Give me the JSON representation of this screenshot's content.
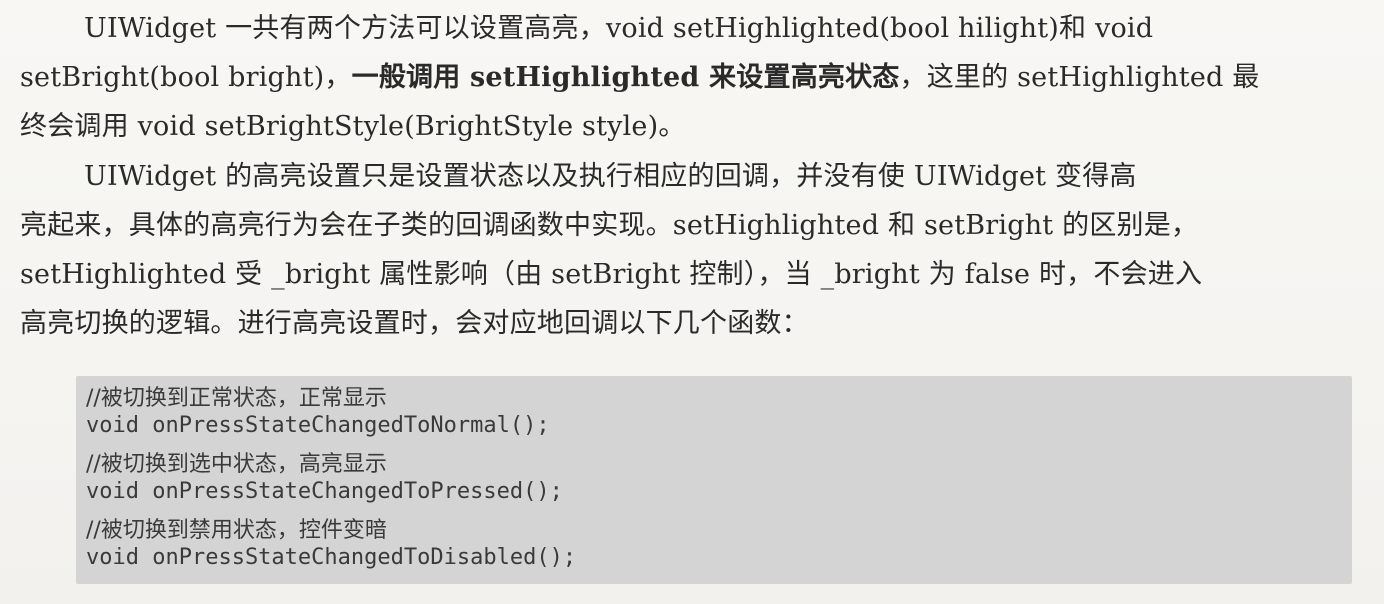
{
  "paragraph1": {
    "line1": "UIWidget 一共有两个方法可以设置高亮，void setHighlighted(bool hilight)和 void",
    "line2_pre": "setBright(bool bright)，",
    "line2_bold": "一般调用 setHighlighted 来设置高亮状态",
    "line2_post": "，这里的 setHighlighted 最",
    "line3": "终会调用 void setBrightStyle(BrightStyle style)。"
  },
  "paragraph2": {
    "line1": "UIWidget 的高亮设置只是设置状态以及执行相应的回调，并没有使 UIWidget 变得高",
    "line2": "亮起来，具体的高亮行为会在子类的回调函数中实现。setHighlighted 和 setBright 的区别是，",
    "line3": "setHighlighted 受 _bright 属性影响（由 setBright 控制），当 _bright 为 false 时，不会进入",
    "line4": "高亮切换的逻辑。进行高亮设置时，会对应地回调以下几个函数："
  },
  "code": {
    "lines": [
      "//被切换到正常状态，正常显示",
      "void onPressStateChangedToNormal();",
      "//被切换到选中状态，高亮显示",
      "void onPressStateChangedToPressed();",
      "//被切换到禁用状态，控件变暗",
      "void onPressStateChangedToDisabled();"
    ]
  }
}
